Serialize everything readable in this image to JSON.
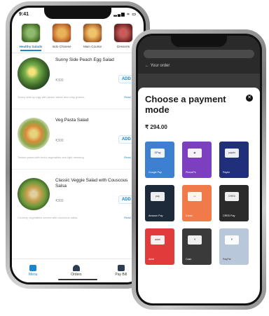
{
  "phone_left": {
    "status_time": "9:41",
    "status_icons": "▂▄▆ ≈ ▭",
    "categories": [
      {
        "label": "Healthy Salads",
        "active": true
      },
      {
        "label": "Indo Chinese",
        "active": false
      },
      {
        "label": "Main Course",
        "active": false
      },
      {
        "label": "Desserts",
        "active": false
      }
    ],
    "items": [
      {
        "name": "Sunny Side Peach Egg Salad",
        "price": "₹300",
        "add": "ADD +",
        "desc": "Sunny side-up egg with peach slices and crisp greens.",
        "read_more": "Read more"
      },
      {
        "name": "Veg Pasta Salad",
        "price": "₹300",
        "add": "ADD +",
        "desc": "Tossed pasta with fresh vegetables and light dressing.",
        "read_more": "Read more"
      },
      {
        "name": "Classic Veggie Salad with Couscous Salsa",
        "price": "₹300",
        "add": "ADD +",
        "desc": "Crunchy vegetables served with couscous salsa.",
        "read_more": "Read more"
      }
    ],
    "nav": [
      {
        "label": "Menu",
        "active": true
      },
      {
        "label": "Orders",
        "active": false
      },
      {
        "label": "Pay Bill",
        "active": false
      }
    ]
  },
  "phone_right": {
    "url": "",
    "back_label": "Your order",
    "sheet_title": "Choose a payment mode",
    "close_icon": "close-icon",
    "amount": "₹ 294.00",
    "methods": [
      {
        "label": "Google Pay",
        "logo": "GPay",
        "color": "#3d7fd1"
      },
      {
        "label": "PhonePe",
        "logo": "◉",
        "color": "#7b3fc0"
      },
      {
        "label": "Paytm",
        "logo": "paytm",
        "color": "#1f2f7a"
      },
      {
        "label": "Amazon Pay",
        "logo": "pay",
        "color": "#1c2a3a"
      },
      {
        "label": "Cards",
        "logo": "▭",
        "color": "#f07a4a"
      },
      {
        "label": "CRED Pay",
        "logo": "CRED",
        "color": "#2a2a2a"
      },
      {
        "label": "Airtel",
        "logo": "airtel",
        "color": "#e23b3b"
      },
      {
        "label": "Cash",
        "logo": "₹",
        "color": "#3a3a3a"
      },
      {
        "label": "PayPal",
        "logo": "P",
        "color": "#b9c7da"
      }
    ]
  },
  "colors": {
    "accent": "#1a86c9"
  }
}
